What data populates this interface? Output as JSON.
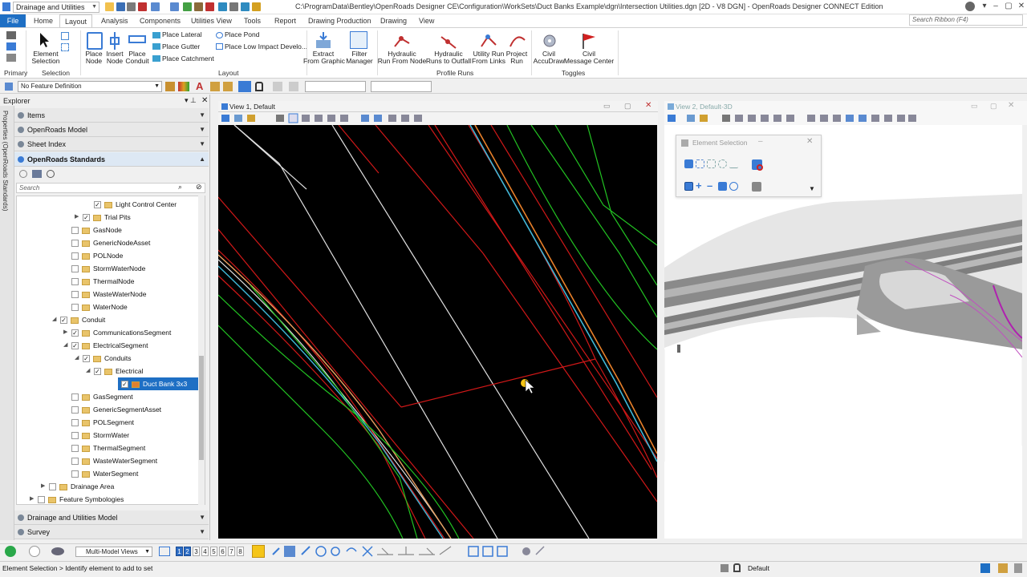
{
  "window": {
    "workspace": "Drainage and Utilities",
    "title": "C:\\ProgramData\\Bentley\\OpenRoads Designer CE\\Configuration\\WorkSets\\Duct Banks Example\\dgn\\Intersection Utilities.dgn [2D - V8 DGN] - OpenRoads Designer CONNECT Edition",
    "search_placeholder": "Search Ribbon (F4)"
  },
  "tabs": [
    "File",
    "Home",
    "Layout",
    "Analysis",
    "Components",
    "Utilities View",
    "Tools",
    "Report",
    "Drawing Production",
    "Drawing",
    "View"
  ],
  "ribbon": {
    "element_selection": "Element\nSelection",
    "place_node": "Place\nNode",
    "insert_node": "Insert\nNode",
    "place_conduit": "Place\nConduit",
    "place_lateral": "Place Lateral",
    "place_gutter": "Place Gutter",
    "place_catchment": "Place Catchment",
    "place_pond": "Place Pond",
    "place_low_impact": "Place Low Impact Develo...",
    "extract_from_graphic": "Extract\nFrom Graphic",
    "filter_manager": "Filter\nManager",
    "hydraulic_run_from_node": "Hydraulic\nRun From Node",
    "hydraulic_runs_to_outfall": "Hydraulic\nRuns to Outfall",
    "utility_run_from_links": "Utility Run\nFrom Links",
    "project_run": "Project\nRun",
    "civil_accudraw": "Civil\nAccuDraw",
    "civil_message_center": "Civil\nMessage Center",
    "groups": {
      "primary": "Primary",
      "selection": "Selection",
      "layout": "Layout",
      "profile_runs": "Profile Runs",
      "toggles": "Toggles"
    }
  },
  "attributes": {
    "feature_definition": "No Feature Definition"
  },
  "explorer": {
    "title": "Explorer",
    "side_tab": "Properties (OpenRoads Standards)",
    "sections_top": [
      "Items",
      "OpenRoads Model",
      "Sheet Index",
      "OpenRoads Standards"
    ],
    "search_placeholder": "Search",
    "sections_bottom": [
      "Drainage and Utilities Model",
      "Survey"
    ],
    "tree": [
      {
        "label": "Light Control Center",
        "level": 4,
        "checked": true,
        "expand": ""
      },
      {
        "label": "Trial Pits",
        "level": 3,
        "checked": true,
        "expand": "▶"
      },
      {
        "label": "GasNode",
        "level": 2,
        "checked": false,
        "expand": ""
      },
      {
        "label": "GenericNodeAsset",
        "level": 2,
        "checked": false,
        "expand": ""
      },
      {
        "label": "POLNode",
        "level": 2,
        "checked": false,
        "expand": ""
      },
      {
        "label": "StormWaterNode",
        "level": 2,
        "checked": false,
        "expand": ""
      },
      {
        "label": "ThermalNode",
        "level": 2,
        "checked": false,
        "expand": ""
      },
      {
        "label": "WasteWaterNode",
        "level": 2,
        "checked": false,
        "expand": ""
      },
      {
        "label": "WaterNode",
        "level": 2,
        "checked": false,
        "expand": ""
      },
      {
        "label": "Conduit",
        "level": 1,
        "checked": true,
        "expand": "◢"
      },
      {
        "label": "CommunicationsSegment",
        "level": 2,
        "checked": true,
        "expand": "▶"
      },
      {
        "label": "ElectricalSegment",
        "level": 2,
        "checked": true,
        "expand": "◢"
      },
      {
        "label": "Conduits",
        "level": 3,
        "checked": true,
        "expand": "◢"
      },
      {
        "label": "Electrical",
        "level": 4,
        "checked": true,
        "expand": "◢"
      },
      {
        "label": "Duct Bank 3x3",
        "level": 5,
        "checked": true,
        "expand": "",
        "selected": true
      },
      {
        "label": "GasSegment",
        "level": 2,
        "checked": false,
        "expand": ""
      },
      {
        "label": "GenericSegmentAsset",
        "level": 2,
        "checked": false,
        "expand": ""
      },
      {
        "label": "POLSegment",
        "level": 2,
        "checked": false,
        "expand": ""
      },
      {
        "label": "StormWater",
        "level": 2,
        "checked": false,
        "expand": ""
      },
      {
        "label": "ThermalSegment",
        "level": 2,
        "checked": false,
        "expand": ""
      },
      {
        "label": "WasteWaterSegment",
        "level": 2,
        "checked": false,
        "expand": ""
      },
      {
        "label": "WaterSegment",
        "level": 2,
        "checked": false,
        "expand": ""
      },
      {
        "label": "Drainage Area",
        "level": 0,
        "checked": false,
        "expand": "▶"
      },
      {
        "label": "Feature Symbologies",
        "level": -1,
        "checked": false,
        "expand": "▶"
      }
    ]
  },
  "view1": {
    "title": "View 1, Default"
  },
  "view2": {
    "title": "View 2, Default-3D"
  },
  "element_selection_dialog": {
    "title": "Element Selection"
  },
  "bottom": {
    "multi_model_views": "Multi-Model Views",
    "view_numbers": [
      "1",
      "2",
      "3",
      "4",
      "5",
      "6",
      "7",
      "8"
    ]
  },
  "status": {
    "prompt": "Element Selection > Identify element to add to set",
    "level": "Default"
  },
  "colors": {
    "accent": "#1e6fc4",
    "red": "#d01818",
    "green": "#22c322",
    "cyan": "#3fb8d8",
    "orange": "#e8802a",
    "white": "#d8d8d8"
  }
}
